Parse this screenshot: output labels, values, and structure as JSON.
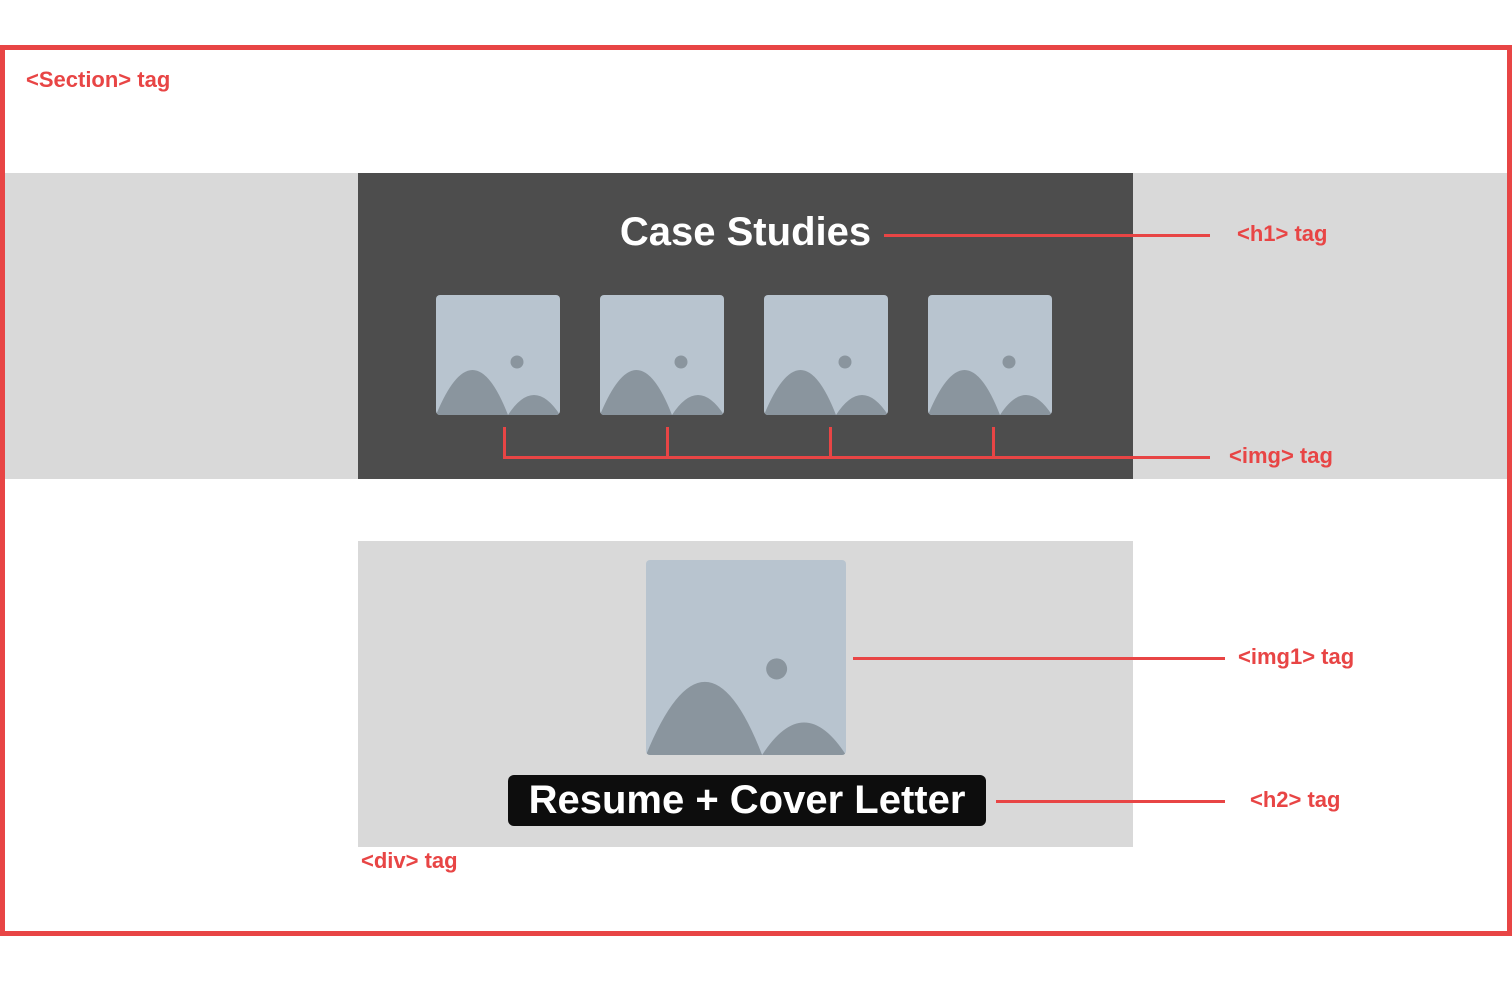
{
  "labels": {
    "section": "<Section> tag",
    "h1": "<h1> tag",
    "img": "<img> tag",
    "img1": "<img1> tag",
    "h2": "<h2> tag",
    "div": "<div> tag"
  },
  "content": {
    "heading": "Case Studies",
    "subheading": "Resume + Cover Letter"
  },
  "colors": {
    "annotation": "#e84545",
    "dark_panel": "#4d4d4d",
    "gray_band": "#d9d9d9",
    "placeholder": "#b8c4cf"
  },
  "icons": [
    "image-placeholder-icon"
  ]
}
